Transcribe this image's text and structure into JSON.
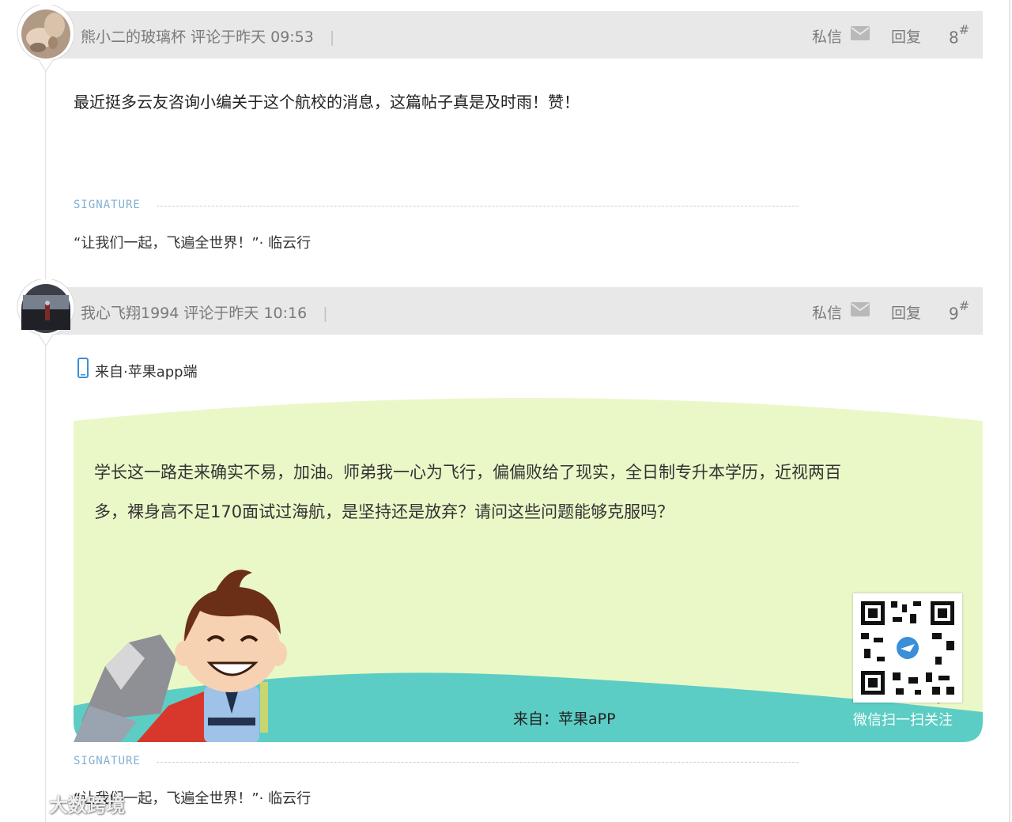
{
  "posts": [
    {
      "author": "熊小二的玻璃杯",
      "meta": "评论于昨天 09:53",
      "separator": "|",
      "message_label": "私信",
      "reply_label": "回复",
      "floor_number": "8",
      "floor_mark": "#",
      "content": "最近挺多云友咨询小编关于这个航校的消息，这篇帖子真是及时雨！赞！",
      "signature_title": "SIGNATURE",
      "signature_text": "“让我们一起，飞遍全世界！”· 临云行"
    },
    {
      "author": "我心飞翔1994",
      "meta": "评论于昨天 10:16",
      "separator": "|",
      "message_label": "私信",
      "reply_label": "回复",
      "floor_number": "9",
      "floor_mark": "#",
      "source_label": "来自·苹果app端",
      "content_lines": [
        "学长这一路走来确实不易，加油。师弟我一心为飞行，偏偏败给了现实，全日制专升本学历，近视两百",
        "多，裸身高不足170面试过海航，是坚持还是放弃？请问这些问题能够克服吗？"
      ],
      "banner_footer": "来自：苹果aPP",
      "qr_caption": "微信扫一扫关注",
      "signature_title": "SIGNATURE",
      "signature_text": "“让我们一起，飞遍全世界！”· 临云行"
    }
  ],
  "watermark": "大数跨境",
  "colors": {
    "header_bg": "#e8e8e8",
    "meta_text": "#7a7a7a",
    "signature_accent": "#7fb0d6",
    "banner_green": "#eaf8c8",
    "banner_teal": "#5ccdc4"
  },
  "icons": [
    "mail-icon",
    "phone-icon",
    "qr-code",
    "mascot"
  ]
}
